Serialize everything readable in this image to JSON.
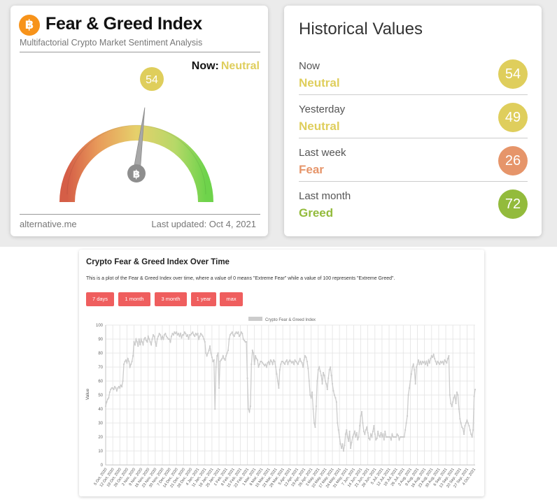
{
  "fear_greed": {
    "title": "Fear & Greed Index",
    "subtitle": "Multifactorial Crypto Market Sentiment Analysis",
    "now_label": "Now:",
    "now_value": "Neutral",
    "index_value": "54",
    "index_level": 54,
    "footer_source": "alternative.me",
    "footer_updated": "Last updated: Oct 4, 2021",
    "colors": {
      "neutral": "#dfce5c",
      "fear": "#e6956a",
      "greed": "#93bb3c",
      "btc": "#f7931a"
    },
    "icons": {
      "brand": "bitcoin-icon",
      "needle_hub": "bitcoin-icon"
    }
  },
  "historical": {
    "title": "Historical Values",
    "rows": [
      {
        "label": "Now",
        "classification": "Neutral",
        "value": "54",
        "color": "#dfce5c"
      },
      {
        "label": "Yesterday",
        "classification": "Neutral",
        "value": "49",
        "color": "#dfce5c"
      },
      {
        "label": "Last week",
        "classification": "Fear",
        "value": "26",
        "color": "#e6956a"
      },
      {
        "label": "Last month",
        "classification": "Greed",
        "value": "72",
        "color": "#93bb3c"
      }
    ]
  },
  "chart_panel": {
    "title": "Crypto Fear & Greed Index Over Time",
    "description": "This is a plot of the Fear & Greed Index over time, where a value of 0 means \"Extreme Fear\" while a value of 100 represents \"Extreme Greed\".",
    "buttons": [
      "7 days",
      "1 month",
      "3 month",
      "1 year",
      "max"
    ],
    "button_color": "#ef5e5e"
  },
  "chart_data": {
    "type": "line",
    "title": "",
    "legend": "Crypto Fear & Greed Index",
    "legend_position": "top",
    "ylabel": "Value",
    "xlabel": "",
    "ylim": [
      0,
      100
    ],
    "yticks": [
      0,
      10,
      20,
      30,
      40,
      50,
      60,
      70,
      80,
      90,
      100
    ],
    "grid": true,
    "series_color": "#cccccc",
    "x_ticks": [
      "5 Oct, 2020",
      "12 Oct, 2020",
      "19 Oct, 2020",
      "26 Oct, 2020",
      "2 Nov, 2020",
      "9 Nov, 2020",
      "16 Nov, 2020",
      "23 Nov, 2020",
      "30 Nov, 2020",
      "7 Dec, 2020",
      "14 Dec, 2020",
      "21 Dec, 2020",
      "28 Dec, 2020",
      "4 Jan, 2021",
      "11 Jan, 2021",
      "18 Jan, 2021",
      "25 Jan, 2021",
      "1 Feb, 2021",
      "8 Feb, 2021",
      "15 Feb, 2021",
      "22 Feb, 2021",
      "1 Mar, 2021",
      "8 Mar, 2021",
      "15 Mar, 2021",
      "22 Mar, 2021",
      "29 Mar, 2021",
      "5 Apr, 2021",
      "12 Apr, 2021",
      "19 Apr, 2021",
      "26 Apr, 2021",
      "3 May, 2021",
      "10 May, 2021",
      "17 May, 2021",
      "24 May, 2021",
      "31 May, 2021",
      "7 Jun, 2021",
      "14 Jun, 2021",
      "21 Jun, 2021",
      "28 Jun, 2021",
      "5 Jul, 2021",
      "12 Jul, 2021",
      "19 Jul, 2021",
      "26 Jul, 2021",
      "2 Aug, 2021",
      "9 Aug, 2021",
      "16 Aug, 2021",
      "23 Aug, 2021",
      "30 Aug, 2021",
      "6 Sep, 2021",
      "13 Sep, 2021",
      "20 Sep, 2021",
      "27 Sep, 2021",
      "4 Oct, 2021"
    ],
    "weekly_values": [
      [
        42,
        45,
        47,
        48,
        52,
        54,
        55
      ],
      [
        55,
        54,
        56,
        55,
        53,
        55,
        56
      ],
      [
        55,
        57,
        56,
        60,
        72,
        74,
        75
      ],
      [
        73,
        76,
        74,
        70,
        72,
        74,
        78
      ],
      [
        88,
        86,
        90,
        88,
        85,
        90,
        86
      ],
      [
        90,
        88,
        86,
        90,
        91,
        89,
        88
      ],
      [
        92,
        90,
        88,
        86,
        90,
        93,
        92
      ],
      [
        88,
        85,
        90,
        92,
        94,
        93,
        90
      ],
      [
        92,
        90,
        93,
        94,
        92,
        91,
        90
      ],
      [
        90,
        88,
        92,
        94,
        93,
        95,
        94
      ],
      [
        95,
        93,
        94,
        92,
        94,
        91,
        93
      ],
      [
        93,
        95,
        94,
        92,
        93,
        90,
        93
      ],
      [
        93,
        94,
        95,
        93,
        92,
        94,
        93
      ],
      [
        94,
        90,
        92,
        94,
        93,
        92,
        90
      ],
      [
        88,
        80,
        78,
        80,
        82,
        85,
        80
      ],
      [
        77,
        74,
        75,
        40,
        70,
        78,
        80
      ],
      [
        55,
        74,
        75,
        76,
        78,
        76,
        75
      ],
      [
        78,
        80,
        82,
        90,
        93,
        94,
        95
      ],
      [
        93,
        92,
        94,
        95,
        94,
        95,
        92
      ],
      [
        93,
        95,
        94,
        90,
        89,
        88,
        88
      ],
      [
        62,
        40,
        38,
        42,
        72,
        82,
        80
      ],
      [
        72,
        78,
        76,
        75,
        70,
        72,
        74
      ],
      [
        74,
        73,
        72,
        71,
        72,
        70,
        73
      ],
      [
        74,
        72,
        75,
        74,
        72,
        75,
        74
      ],
      [
        70,
        65,
        60,
        55,
        68,
        72,
        74
      ],
      [
        74,
        73,
        72,
        74,
        75,
        72,
        74
      ],
      [
        75,
        74,
        73,
        74,
        72,
        75,
        74
      ],
      [
        73,
        72,
        74,
        76,
        74,
        73,
        70
      ],
      [
        75,
        78,
        77,
        74,
        69,
        60,
        50
      ],
      [
        48,
        52,
        40,
        30,
        27,
        42,
        60
      ],
      [
        68,
        70,
        67,
        64,
        58,
        66,
        64
      ],
      [
        60,
        58,
        54,
        62,
        68,
        70,
        64
      ],
      [
        58,
        53,
        50,
        48,
        45,
        30,
        25
      ],
      [
        20,
        15,
        12,
        15,
        10,
        14,
        22
      ],
      [
        25,
        20,
        17,
        24,
        12,
        16,
        20
      ],
      [
        22,
        24,
        20,
        23,
        18,
        20,
        28
      ],
      [
        35,
        38,
        30,
        24,
        22,
        25,
        27
      ],
      [
        23,
        19,
        18,
        22,
        20,
        24,
        28
      ],
      [
        22,
        18,
        19,
        24,
        21,
        20,
        23
      ],
      [
        20,
        22,
        18,
        24,
        20,
        20,
        20
      ],
      [
        20,
        20,
        18,
        22,
        20,
        20,
        20
      ],
      [
        20,
        22,
        21,
        18,
        20,
        20,
        20
      ],
      [
        20,
        20,
        25,
        30,
        35,
        50,
        55
      ],
      [
        60,
        65,
        70,
        72,
        68,
        58,
        70
      ],
      [
        72,
        75,
        72,
        74,
        72,
        74,
        73
      ],
      [
        74,
        72,
        74,
        71,
        75,
        73,
        76
      ],
      [
        78,
        77,
        79,
        76,
        74,
        72,
        74
      ],
      [
        73,
        72,
        74,
        73,
        74,
        72,
        75
      ],
      [
        74,
        73,
        76,
        78,
        50,
        44,
        42
      ],
      [
        45,
        48,
        50,
        44,
        52,
        50,
        40
      ],
      [
        33,
        30,
        27,
        26,
        22,
        28,
        30
      ],
      [
        32,
        30,
        28,
        25,
        22,
        20,
        25
      ],
      [
        49,
        54
      ]
    ]
  }
}
